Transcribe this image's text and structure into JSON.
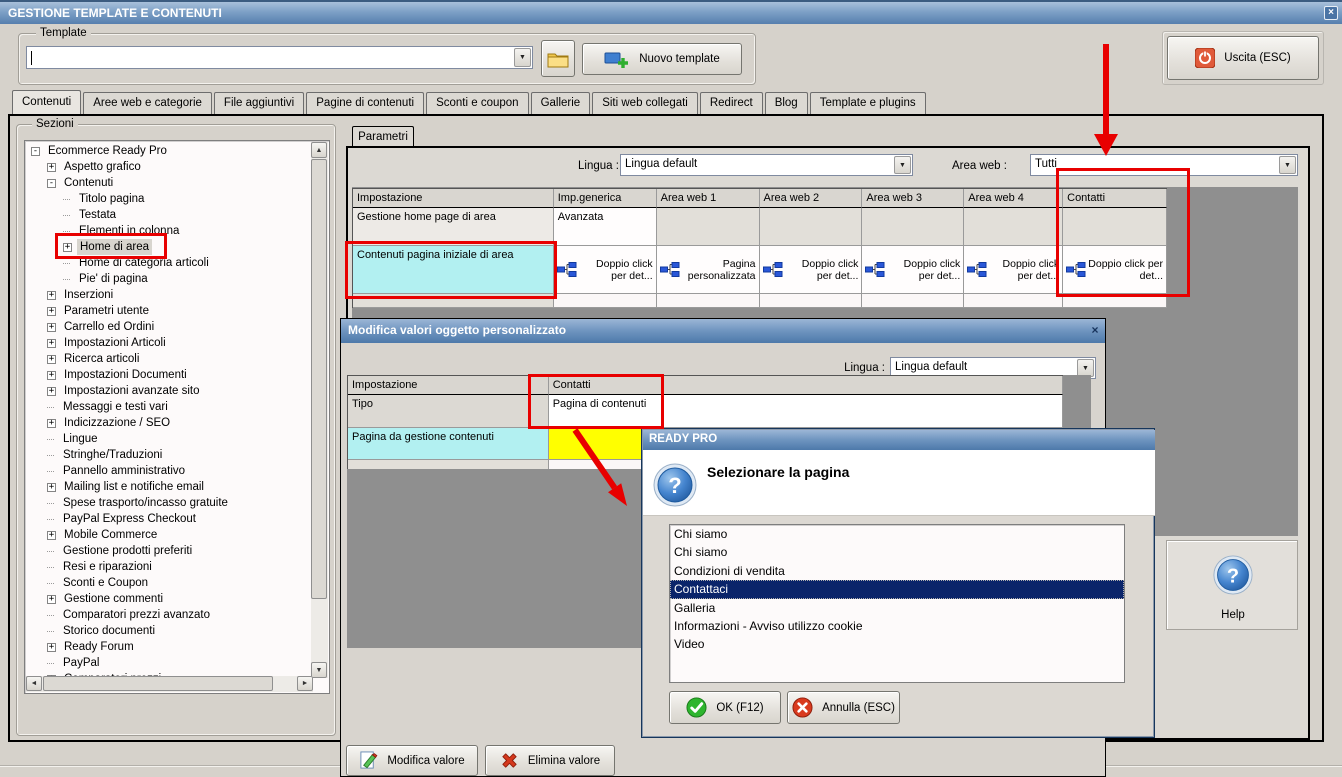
{
  "window": {
    "title": "GESTIONE TEMPLATE E CONTENUTI",
    "close_glyph": "×"
  },
  "toolbar": {
    "template_label": "Template",
    "template_value": "",
    "new_template_label": "Nuovo template",
    "exit_label": "Uscita (ESC)"
  },
  "tabs": [
    "Contenuti",
    "Aree web e categorie",
    "File aggiuntivi",
    "Pagine di contenuti",
    "Sconti e coupon",
    "Gallerie",
    "Siti web collegati",
    "Redirect",
    "Blog",
    "Template e plugins"
  ],
  "active_tab": "Contenuti",
  "sezioni": {
    "label": "Sezioni",
    "tree": [
      {
        "label": "Ecommerce Ready Pro",
        "level": 0,
        "glyph": "minus"
      },
      {
        "label": "Aspetto grafico",
        "level": 1,
        "glyph": "plus"
      },
      {
        "label": "Contenuti",
        "level": 1,
        "glyph": "minus"
      },
      {
        "label": "Titolo pagina",
        "level": 2,
        "glyph": "leaf"
      },
      {
        "label": "Testata",
        "level": 2,
        "glyph": "leaf"
      },
      {
        "label": "Elementi in colonna",
        "level": 2,
        "glyph": "leaf"
      },
      {
        "label": "Home di area",
        "level": 2,
        "glyph": "plus",
        "selected": true
      },
      {
        "label": "Home di categoria articoli",
        "level": 2,
        "glyph": "leaf"
      },
      {
        "label": "Pie' di pagina",
        "level": 2,
        "glyph": "leaf"
      },
      {
        "label": "Inserzioni",
        "level": 1,
        "glyph": "plus"
      },
      {
        "label": "Parametri utente",
        "level": 1,
        "glyph": "plus"
      },
      {
        "label": "Carrello ed Ordini",
        "level": 1,
        "glyph": "plus"
      },
      {
        "label": "Impostazioni Articoli",
        "level": 1,
        "glyph": "plus"
      },
      {
        "label": "Ricerca articoli",
        "level": 1,
        "glyph": "plus"
      },
      {
        "label": "Impostazioni Documenti",
        "level": 1,
        "glyph": "plus"
      },
      {
        "label": "Impostazioni avanzate sito",
        "level": 1,
        "glyph": "plus"
      },
      {
        "label": "Messaggi e testi vari",
        "level": 1,
        "glyph": "leaf"
      },
      {
        "label": "Indicizzazione / SEO",
        "level": 1,
        "glyph": "plus"
      },
      {
        "label": "Lingue",
        "level": 1,
        "glyph": "leaf"
      },
      {
        "label": "Stringhe/Traduzioni",
        "level": 1,
        "glyph": "leaf"
      },
      {
        "label": "Pannello amministrativo",
        "level": 1,
        "glyph": "leaf"
      },
      {
        "label": "Mailing list e notifiche email",
        "level": 1,
        "glyph": "plus"
      },
      {
        "label": "Spese trasporto/incasso gratuite",
        "level": 1,
        "glyph": "leaf"
      },
      {
        "label": "PayPal Express Checkout",
        "level": 1,
        "glyph": "leaf"
      },
      {
        "label": "Mobile Commerce",
        "level": 1,
        "glyph": "plus"
      },
      {
        "label": "Gestione prodotti preferiti",
        "level": 1,
        "glyph": "leaf"
      },
      {
        "label": "Resi e riparazioni",
        "level": 1,
        "glyph": "leaf"
      },
      {
        "label": "Sconti e Coupon",
        "level": 1,
        "glyph": "leaf"
      },
      {
        "label": "Gestione commenti",
        "level": 1,
        "glyph": "plus"
      },
      {
        "label": "Comparatori prezzi avanzato",
        "level": 1,
        "glyph": "leaf"
      },
      {
        "label": "Storico documenti",
        "level": 1,
        "glyph": "leaf"
      },
      {
        "label": "Ready Forum",
        "level": 1,
        "glyph": "plus"
      },
      {
        "label": "PayPal",
        "level": 1,
        "glyph": "leaf"
      },
      {
        "label": "Comparatori prezzi",
        "level": 1,
        "glyph": "plus"
      }
    ]
  },
  "parametri": {
    "tab_label": "Parametri",
    "lingua_label": "Lingua :",
    "lingua_value": "Lingua default",
    "area_web_label": "Area web :",
    "area_web_value": "Tutti",
    "grid": {
      "columns": [
        "Impostazione",
        "Imp.generica",
        "Area web 1",
        "Area web 2",
        "Area web 3",
        "Area web 4",
        "Contatti"
      ],
      "rows": [
        {
          "impostazione": "Gestione home page di area",
          "cells": [
            "Avanzata",
            "",
            "",
            "",
            "",
            ""
          ],
          "icons": [
            false,
            false,
            false,
            false,
            false,
            false
          ]
        },
        {
          "impostazione": "Contenuti pagina iniziale di area",
          "cells": [
            "Doppio click per det...",
            "Pagina personalizzata",
            "Doppio click per det...",
            "Doppio click per det...",
            "Doppio click per det...",
            "Doppio click per det..."
          ],
          "icons": [
            true,
            true,
            true,
            true,
            true,
            true
          ]
        }
      ]
    },
    "help_label": "Help"
  },
  "dialog": {
    "title": "Modifica valori oggetto personalizzato",
    "close_glyph": "×",
    "lingua_label": "Lingua :",
    "lingua_value": "Lingua default",
    "grid_header": [
      "Impostazione",
      "Contatti"
    ],
    "rows": [
      {
        "label": "Tipo",
        "value": "Pagina di contenuti"
      },
      {
        "label": "Pagina da gestione contenuti",
        "value": ""
      }
    ],
    "modify_label": "Modifica valore",
    "delete_label": "Elimina valore"
  },
  "popup": {
    "title": "READY PRO",
    "heading": "Selezionare la pagina",
    "items": [
      "Chi siamo",
      "Chi siamo",
      "Condizioni di vendita",
      "Contattaci",
      "Galleria",
      "Informazioni - Avviso utilizzo cookie",
      "Video"
    ],
    "selected_index": 3,
    "selected_item": "Contattaci",
    "ok_label": "OK (F12)",
    "cancel_label": "Annulla (ESC)"
  },
  "colors": {
    "annotation_red": "#e80000",
    "highlight_cyan": "#b2f0f1",
    "highlight_yellow": "#ffff00",
    "selection_navy": "#0a246a",
    "titlebar_top": "#a9c0da",
    "titlebar_bottom": "#567fae",
    "empty_area_gray": "#8f8f8f"
  }
}
